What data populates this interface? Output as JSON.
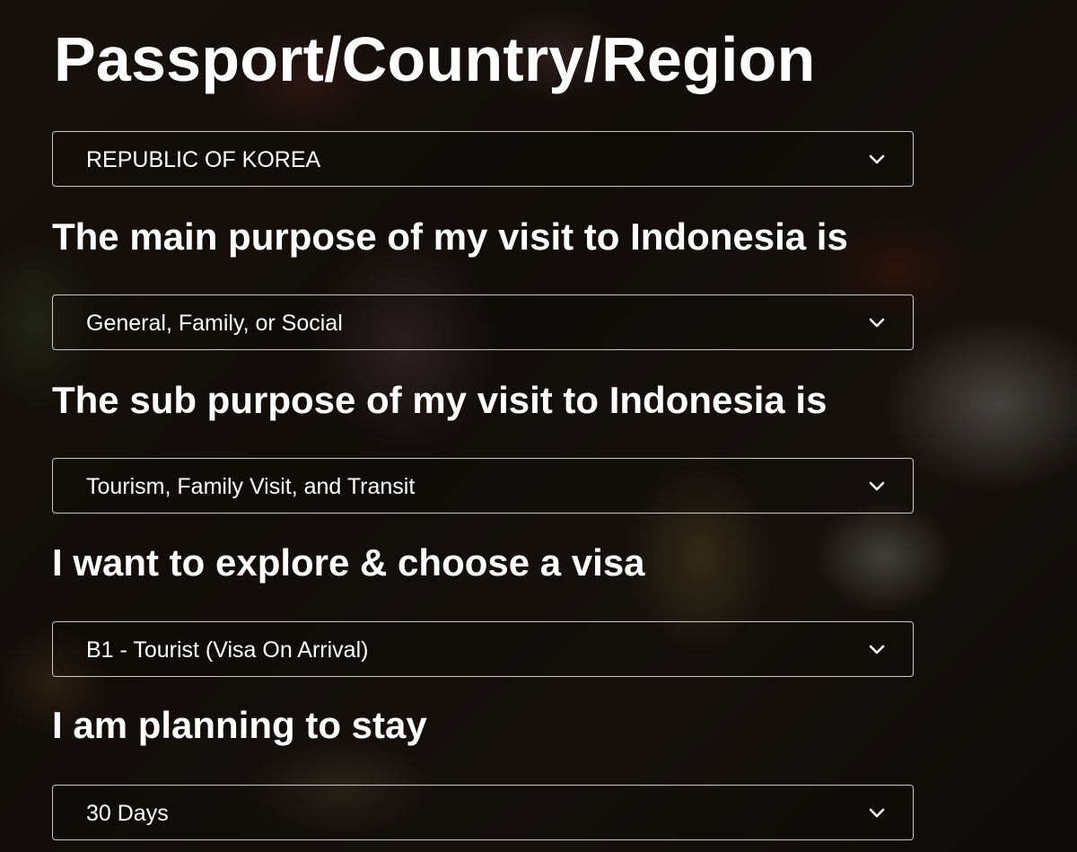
{
  "form": {
    "passport_title": "Passport/Country/Region",
    "passport_value": "REPUBLIC OF KOREA",
    "main_purpose_label": "The main purpose of my visit to Indonesia is",
    "main_purpose_value": "General, Family, or Social",
    "sub_purpose_label": "The sub purpose of my visit to Indonesia is",
    "sub_purpose_value": "Tourism, Family Visit, and Transit",
    "visa_label": "I want to explore & choose a visa",
    "visa_value": "B1 - Tourist (Visa On Arrival)",
    "stay_label": "I am planning to stay",
    "stay_value": "30 Days"
  },
  "icons": {
    "dropdown": "chevron-down-icon"
  },
  "colors": {
    "text": "#ffffff",
    "field_border": "#cfc9c2"
  }
}
